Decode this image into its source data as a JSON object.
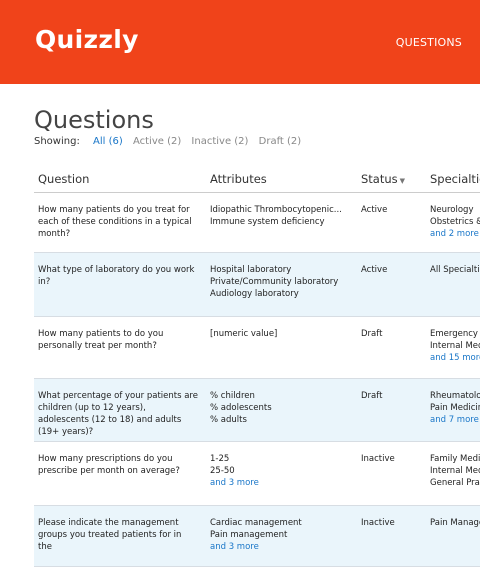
{
  "header": {
    "logo": "Quizzly",
    "nav_questions": "QUESTIONS"
  },
  "page": {
    "title": "Questions"
  },
  "filters": {
    "label": "Showing:",
    "all": "All (6)",
    "active": "Active (2)",
    "inactive": "Inactive (2)",
    "draft": "Draft (2)"
  },
  "table": {
    "columns": {
      "question": "Question",
      "attributes": "Attributes",
      "status": "Status",
      "specialties": "Specialties"
    },
    "rows": [
      {
        "question": "How many patients do you treat for each of these conditions in a typical month?",
        "attributes": [
          "Idiopathic Thrombocytopenic...",
          "Immune system deficiency"
        ],
        "attributes_more": "",
        "status": "Active",
        "specialties": [
          "Neurology",
          "Obstetrics &"
        ],
        "specialties_more": "and 2 more"
      },
      {
        "question": "What type of laboratory do you work in?",
        "attributes": [
          "Hospital laboratory",
          "Private/Community laboratory",
          "Audiology laboratory"
        ],
        "attributes_more": "",
        "status": "Active",
        "specialties": [
          "All Specialties"
        ],
        "specialties_more": ""
      },
      {
        "question": "How many patients to do you personally treat per month?",
        "attributes": [
          "[numeric value]"
        ],
        "attributes_more": "",
        "status": "Draft",
        "specialties": [
          "Emergency M",
          "Internal Med"
        ],
        "specialties_more": "and 15 more"
      },
      {
        "question": "What percentage of your patients are children (up to 12 years), adolescents (12 to 18) and adults (19+ years)?",
        "attributes": [
          "% children",
          "% adolescents",
          "% adults"
        ],
        "attributes_more": "",
        "status": "Draft",
        "specialties": [
          "Rheumatolog",
          "Pain Medicin"
        ],
        "specialties_more": "and 7 more"
      },
      {
        "question": "How many prescriptions do you prescribe per month on average?",
        "attributes": [
          "1-25",
          "25-50"
        ],
        "attributes_more": "and 3 more",
        "status": "Inactive",
        "specialties": [
          "Family Medi",
          "Internal Med",
          "General Prac"
        ],
        "specialties_more": ""
      },
      {
        "question": "Please indicate the management groups you treated patients for in the",
        "attributes": [
          "Cardiac management",
          "Pain management"
        ],
        "attributes_more": "and 3 more",
        "status": "Inactive",
        "specialties": [
          "Pain Manage"
        ],
        "specialties_more": ""
      }
    ]
  },
  "colors": {
    "brand": "#f0431a",
    "link": "#1976c8",
    "row_alt": "#eaf5fb"
  }
}
